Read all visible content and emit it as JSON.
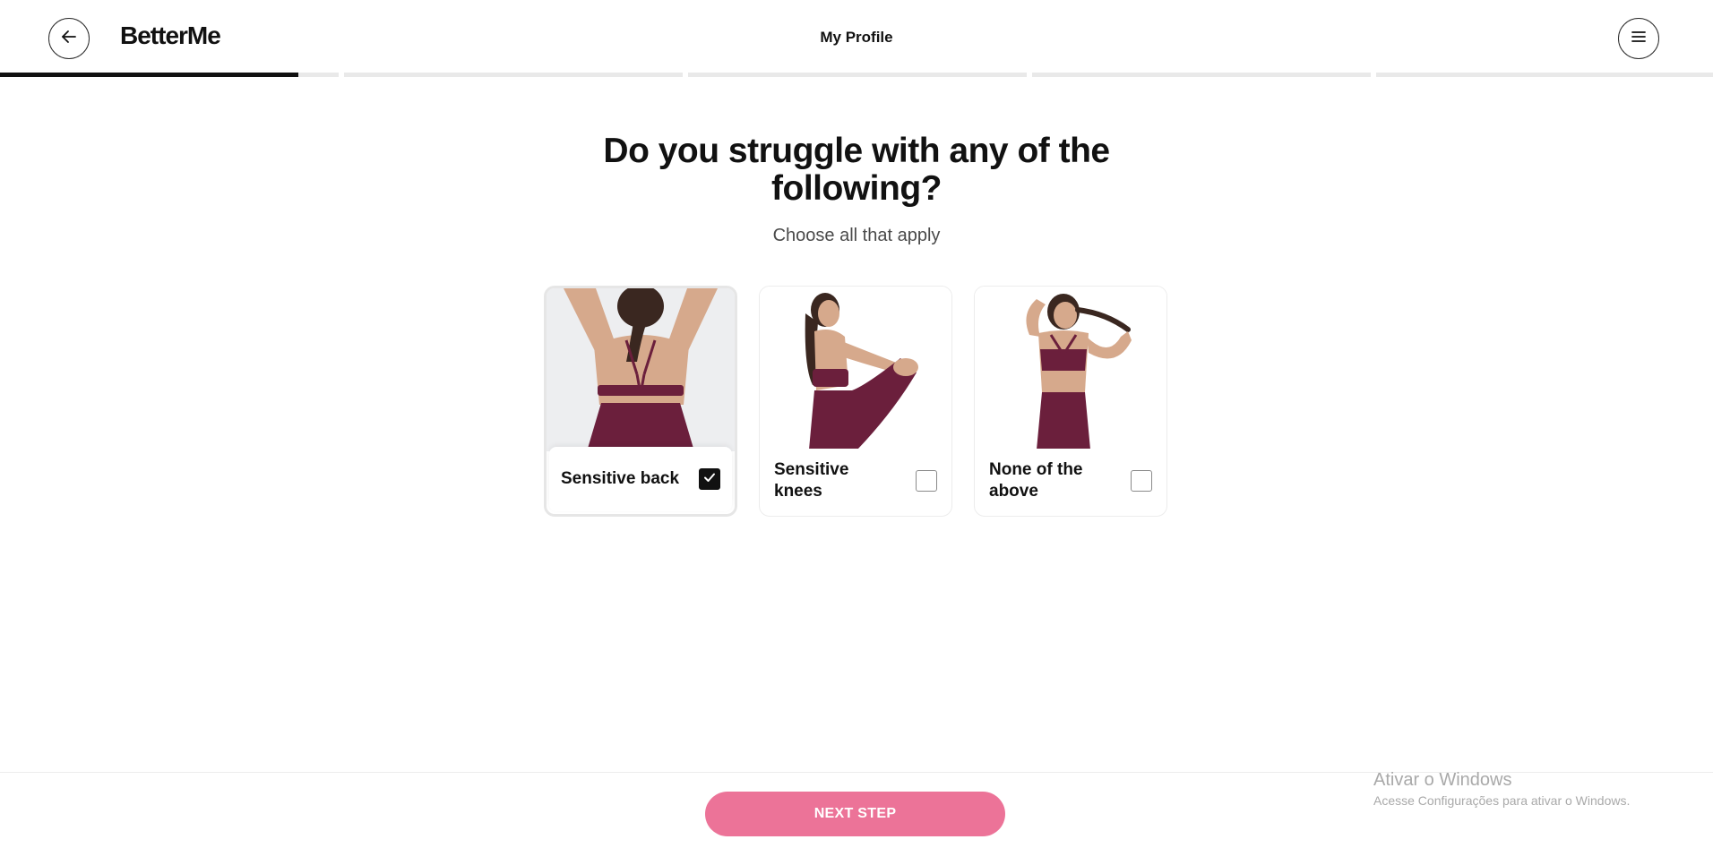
{
  "header": {
    "logo": "BetterMe",
    "title": "My Profile",
    "back_icon": "arrow-left-icon",
    "menu_icon": "hamburger-menu-icon"
  },
  "progress": {
    "segments": 5,
    "current_segment": 1,
    "current_segment_fill": 0.88,
    "fill_color": "#111111",
    "track_color": "#e9e9e9"
  },
  "question": {
    "title": "Do you struggle with any of the following?",
    "subtitle": "Choose all that apply"
  },
  "options": [
    {
      "label": "Sensitive back",
      "checked": true,
      "image": "woman-back-view-photo"
    },
    {
      "label": "Sensitive knees",
      "checked": false,
      "image": "woman-sitting-holding-knee-photo"
    },
    {
      "label": "None of the above",
      "checked": false,
      "image": "woman-standing-holding-ponytail-photo"
    }
  ],
  "footer": {
    "next_label": "NEXT STEP",
    "accent_color": "#ec7398"
  },
  "watermark": {
    "title": "Ativar o Windows",
    "subtitle": "Acesse Configurações para ativar o Windows."
  },
  "colors": {
    "outfit": "#6b1f3c",
    "skin": "#d6a98c",
    "hair": "#3a2720",
    "photo_bg_gray": "#edeef0"
  }
}
